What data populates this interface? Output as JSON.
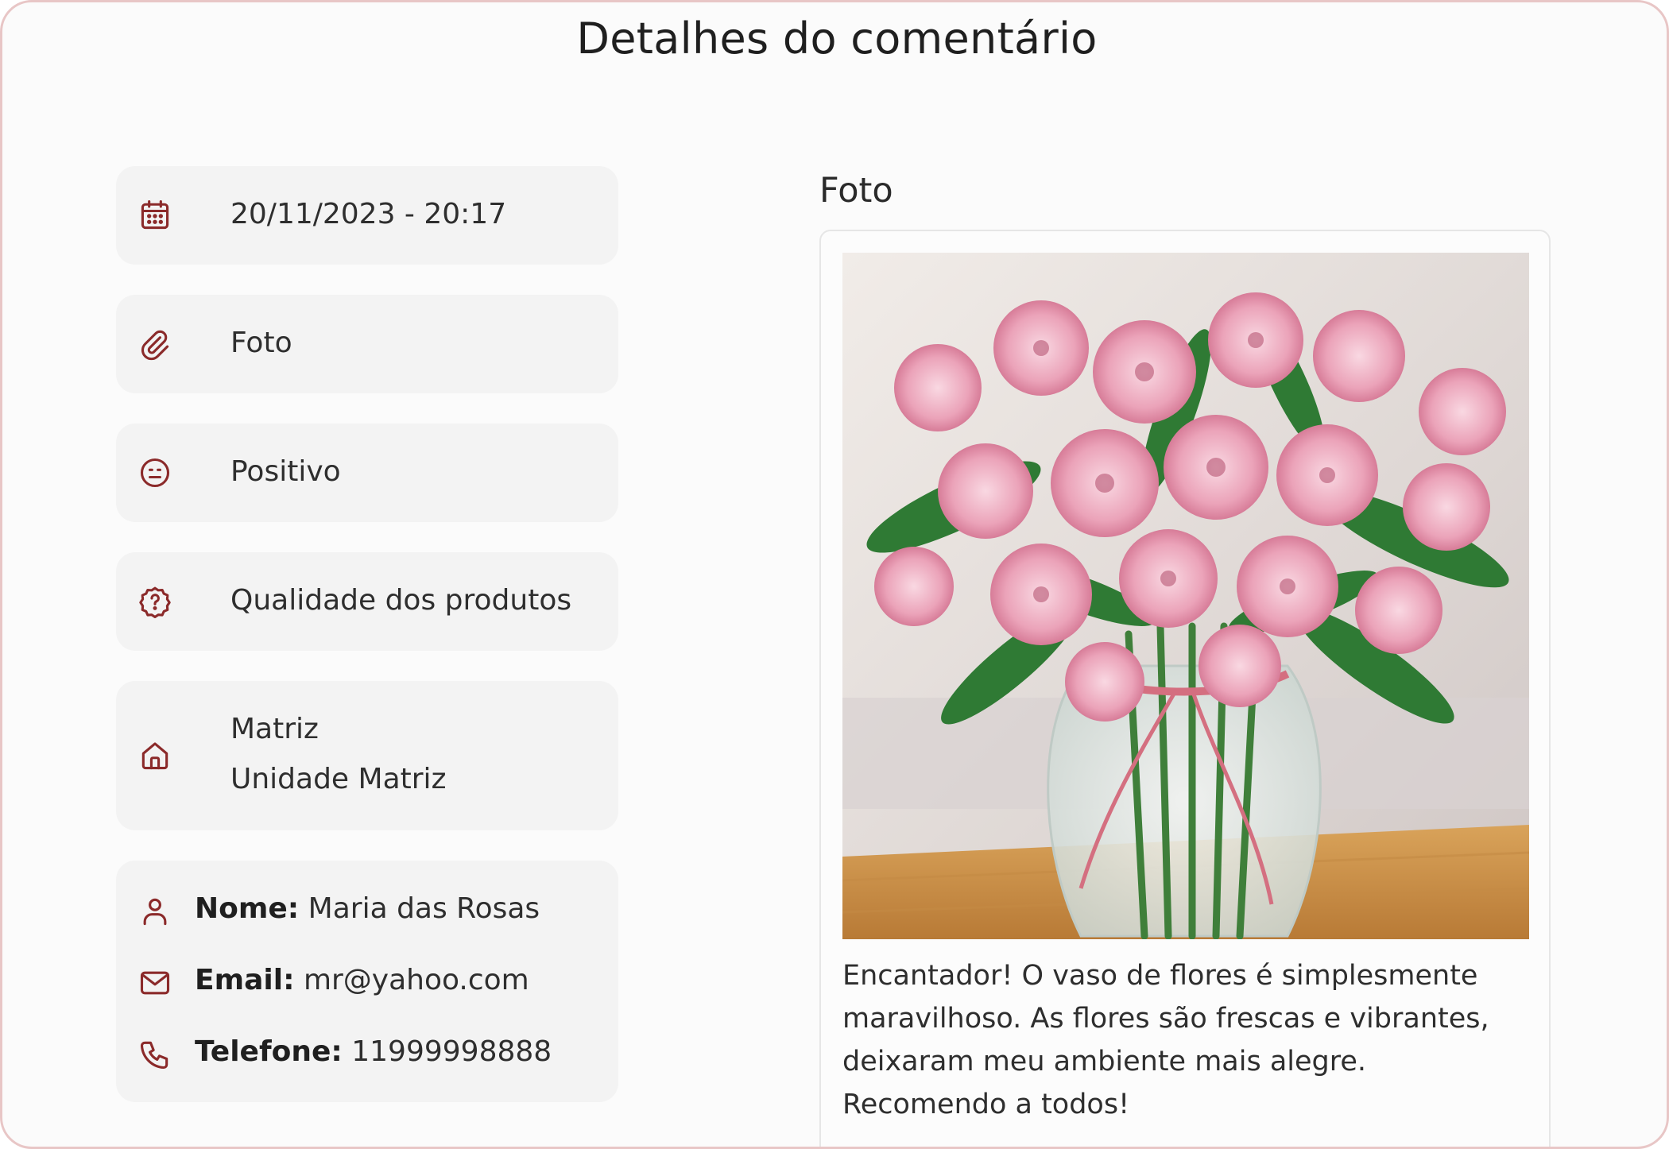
{
  "dialog": {
    "title": "Detalhes do comentário"
  },
  "details": {
    "datetime": "20/11/2023 - 20:17",
    "attachment_type": "Foto",
    "sentiment": "Positivo",
    "category": "Qualidade dos produtos",
    "unit": {
      "name": "Matriz",
      "description": "Unidade Matriz"
    }
  },
  "contact": {
    "name_label": "Nome:",
    "name_value": "Maria das Rosas",
    "email_label": "Email:",
    "email_value": "mr@yahoo.com",
    "phone_label": "Telefone:",
    "phone_value": "11999998888"
  },
  "photo_section": {
    "label": "Foto",
    "comment": "Encantador! O vaso de flores é simplesmente maravilhoso. As flores são frescas e vibrantes, deixaram meu ambiente mais alegre. Recomendo a todos!"
  },
  "icons": {
    "datetime": "calendar-icon",
    "attachment": "paperclip-icon",
    "sentiment": "face-icon",
    "category": "question-badge-icon",
    "unit": "home-icon",
    "name": "user-icon",
    "email": "mail-icon",
    "phone": "phone-icon"
  },
  "colors": {
    "icon_accent": "#8b2a2a",
    "card_background": "#f3f3f3",
    "dialog_border": "#e8c6c6"
  }
}
